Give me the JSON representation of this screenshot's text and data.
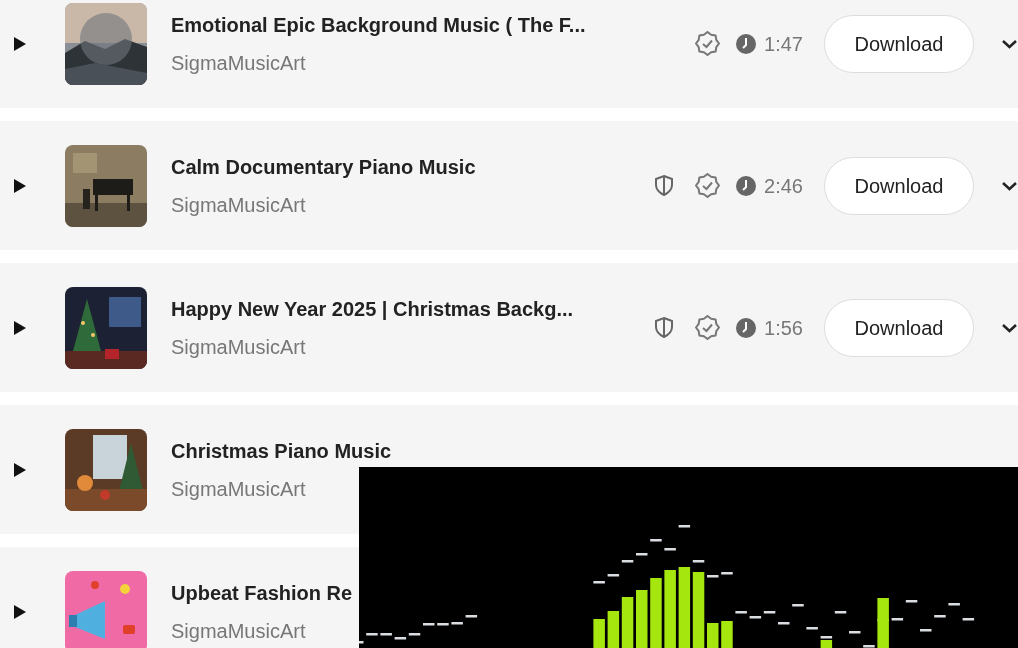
{
  "tracks": [
    {
      "title": "Emotional Epic Background Music ( The F...",
      "artist": "SigmaMusicArt",
      "protected": false,
      "verified": true,
      "duration": "1:47",
      "button": "Download"
    },
    {
      "title": "Calm Documentary Piano Music",
      "artist": "SigmaMusicArt",
      "protected": true,
      "verified": true,
      "duration": "2:46",
      "button": "Download"
    },
    {
      "title": "Happy New Year 2025 | Christmas Backg...",
      "artist": "SigmaMusicArt",
      "protected": true,
      "verified": true,
      "duration": "1:56",
      "button": "Download"
    },
    {
      "title": "Christmas Piano Music",
      "artist": "SigmaMusicArt"
    },
    {
      "title": "Upbeat Fashion Re",
      "artist": "SigmaMusicArt"
    }
  ]
}
